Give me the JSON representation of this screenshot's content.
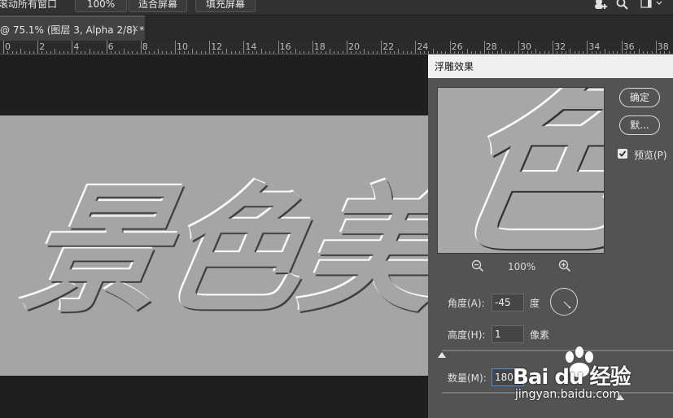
{
  "options_bar": {
    "scroll_all_label": "滚动所有窗口",
    "zoom_100_label": "100%",
    "fit_screen_label": "适合屏幕",
    "fill_screen_label": "填充屏幕"
  },
  "document_tab": {
    "title": "@ 75.1% (图层 3, Alpha 2/8) *",
    "close_glyph": "×"
  },
  "ruler": {
    "labels": [
      "0",
      "2",
      "4",
      "6",
      "8",
      "10",
      "12",
      "14",
      "16",
      "18",
      "20",
      "22",
      "24",
      "26",
      "28",
      "30",
      "32",
      "34",
      "36",
      "38"
    ]
  },
  "canvas": {
    "text": "景色美"
  },
  "dialog": {
    "title": "浮雕效果",
    "ok_label": "确定",
    "default_label": "默...",
    "preview_label": "预览(P)",
    "preview_checked": true,
    "preview_text": "色",
    "zoom_value": "100%",
    "angle": {
      "label": "角度(A):",
      "value": "-45",
      "unit": "度"
    },
    "height": {
      "label": "高度(H):",
      "value": "1",
      "unit": "像素"
    },
    "amount": {
      "label": "数量(M):",
      "value": "180"
    }
  },
  "watermark": {
    "brand": "Bai du 经验",
    "url": "jingyan.baidu.com"
  },
  "icons": [
    "search-icon",
    "workspace-icon",
    "user-icon",
    "zoom-out-icon",
    "zoom-in-icon",
    "checkbox-check-icon",
    "close-icon"
  ]
}
